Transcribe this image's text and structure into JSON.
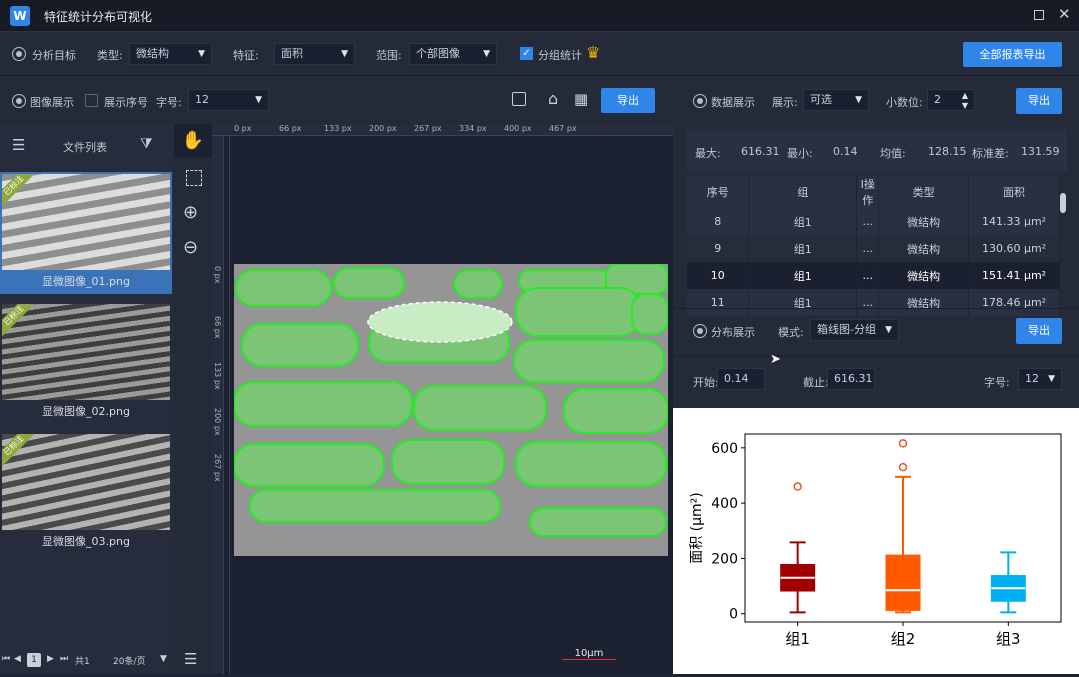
{
  "app": {
    "title": "特征统计分布可视化",
    "logo": "W"
  },
  "toolbar1": {
    "target_label": "分析目标",
    "type_label": "类型:",
    "type_value": "微结构",
    "feature_label": "特征:",
    "feature_value": "面积",
    "range_label": "范围:",
    "range_value": "个部图像",
    "group_label": "分组统计",
    "export_all": "全部报表导出"
  },
  "toolbar2": {
    "image_display": "图像展示",
    "show_index": "展示序号",
    "font_label": "字号:",
    "font_value": "12",
    "export": "导出"
  },
  "sidebar": {
    "title": "文件列表",
    "files": [
      {
        "name": "显微图像_01.png",
        "tag": "已标注"
      },
      {
        "name": "显微图像_02.png",
        "tag": "已标注"
      },
      {
        "name": "显微图像_03.png",
        "tag": "已标注"
      }
    ],
    "pager": {
      "page": "1",
      "total": "共1",
      "per_page": "20条/页"
    }
  },
  "ruler": {
    "top": [
      "0 px",
      "66 px",
      "133 px",
      "200 px",
      "267 px",
      "334 px",
      "400 px",
      "467 px"
    ],
    "left": [
      "0 px",
      "66 px",
      "133 px",
      "200 px",
      "267 px"
    ]
  },
  "scalebar": "10μm",
  "data_panel": {
    "title": "数据展示",
    "show_label": "展示:",
    "show_value": "可选",
    "decimal_label": "小数位:",
    "decimal_value": "2",
    "export": "导出",
    "stats": [
      {
        "label": "最大:",
        "value": "616.31"
      },
      {
        "label": "最小:",
        "value": "0.14"
      },
      {
        "label": "均值:",
        "value": "128.15"
      },
      {
        "label": "标准差:",
        "value": "131.59"
      }
    ],
    "columns": [
      "序号",
      "组",
      "I操作",
      "类型",
      "面积"
    ],
    "rows": [
      [
        "8",
        "组1",
        "...",
        "微结构",
        "141.33 μm²"
      ],
      [
        "9",
        "组1",
        "...",
        "微结构",
        "130.60 μm²"
      ],
      [
        "10",
        "组1",
        "...",
        "微结构",
        "151.41 μm²"
      ],
      [
        "11",
        "组1",
        "...",
        "微结构",
        "178.46 μm²"
      ]
    ]
  },
  "dist_panel": {
    "title": "分布展示",
    "mode_label": "模式:",
    "mode_value": "箱线图-分组",
    "export": "导出",
    "start_label": "开始:",
    "start_value": "0.14",
    "end_label": "截止:",
    "end_value": "616.31",
    "font_label": "字号:",
    "font_value": "12"
  },
  "chart_data": {
    "type": "box",
    "ylabel": "面积 (μm²)",
    "ylim": [
      -30,
      650
    ],
    "yticks": [
      0,
      200,
      400,
      600
    ],
    "categories": [
      "组1",
      "组2",
      "组3"
    ],
    "colors": [
      "#a00000",
      "#ff5a00",
      "#00b0f0"
    ],
    "boxes": [
      {
        "min": 5,
        "q1": 82,
        "median": 130,
        "q3": 178,
        "max": 258,
        "outliers": [
          460
        ]
      },
      {
        "min": 5,
        "q1": 12,
        "median": 85,
        "q3": 212,
        "max": 495,
        "outliers": [
          530,
          616
        ]
      },
      {
        "min": 5,
        "q1": 45,
        "median": 92,
        "q3": 138,
        "max": 222,
        "outliers": []
      }
    ]
  }
}
